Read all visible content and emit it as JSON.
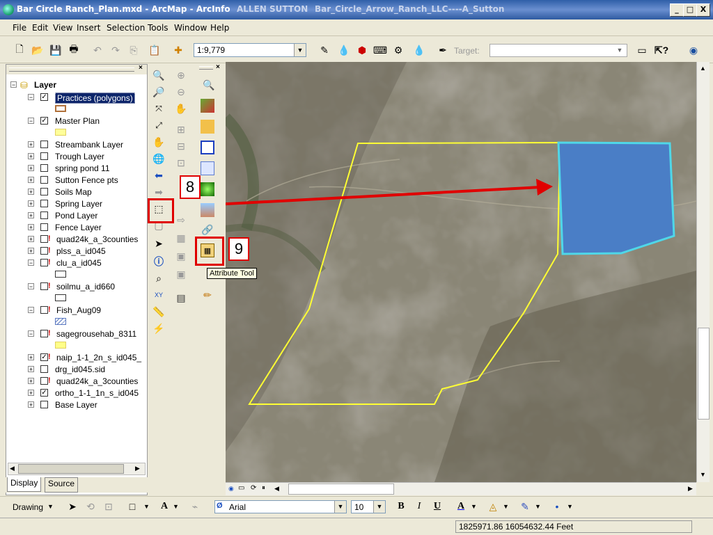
{
  "window": {
    "title": "Bar Circle Ranch_Plan.mxd - ArcMap - ArcInfo",
    "user": "ALLEN SUTTON",
    "folder": "Bar_Circle_Arrow_Ranch_LLC----A_Sutton",
    "min": "_",
    "max": "□",
    "close": "X"
  },
  "menu": [
    "File",
    "Edit",
    "View",
    "Insert",
    "Selection",
    "Tools",
    "Window",
    "Help"
  ],
  "toolbar": {
    "scale": "1:9,779",
    "target_label": "Target:"
  },
  "toc": {
    "root": "Layer",
    "layers": [
      {
        "name": "Practices (polygons)",
        "checked": true,
        "expanded": true,
        "warn": false,
        "selected": true,
        "symbol": "#b0703a"
      },
      {
        "name": "Master Plan",
        "checked": true,
        "expanded": true,
        "warn": false,
        "symbol": "#ffff99"
      },
      {
        "name": "Streambank Layer",
        "checked": false,
        "expanded": false,
        "warn": false
      },
      {
        "name": "Trough Layer",
        "checked": false,
        "expanded": false,
        "warn": false
      },
      {
        "name": "spring pond 11",
        "checked": false,
        "expanded": false,
        "warn": false
      },
      {
        "name": "Sutton Fence pts",
        "checked": false,
        "expanded": false,
        "warn": false
      },
      {
        "name": "Soils Map",
        "checked": false,
        "expanded": false,
        "warn": false
      },
      {
        "name": "Spring Layer",
        "checked": false,
        "expanded": false,
        "warn": false
      },
      {
        "name": "Pond Layer",
        "checked": false,
        "expanded": false,
        "warn": false
      },
      {
        "name": "Fence Layer",
        "checked": false,
        "expanded": false,
        "warn": false
      },
      {
        "name": "quad24k_a_3counties",
        "checked": false,
        "expanded": false,
        "warn": true
      },
      {
        "name": "plss_a_id045",
        "checked": false,
        "expanded": false,
        "warn": true
      },
      {
        "name": "clu_a_id045",
        "checked": false,
        "expanded": true,
        "warn": true,
        "symbol": "#ffffff"
      },
      {
        "name": "soilmu_a_id660",
        "checked": false,
        "expanded": true,
        "warn": true,
        "symbol": "#ffffff"
      },
      {
        "name": "Fish_Aug09",
        "checked": false,
        "expanded": true,
        "warn": true,
        "symbol": "hatch"
      },
      {
        "name": "sagegrousehab_8311",
        "checked": false,
        "expanded": true,
        "warn": true,
        "symbol": "#ffff88"
      },
      {
        "name": "naip_1-1_2n_s_id045_",
        "checked": true,
        "expanded": false,
        "warn": true
      },
      {
        "name": "drg_id045.sid",
        "checked": false,
        "expanded": false,
        "warn": false
      },
      {
        "name": "quad24k_a_3counties",
        "checked": false,
        "expanded": false,
        "warn": true
      },
      {
        "name": "ortho_1-1_1n_s_id045",
        "checked": true,
        "expanded": false,
        "warn": false
      },
      {
        "name": "Base Layer",
        "checked": false,
        "expanded": false,
        "warn": false
      }
    ],
    "tabs": [
      "Display",
      "Source"
    ]
  },
  "annotations": {
    "step8": "8",
    "step9": "9",
    "tooltip": "Attribute Tool"
  },
  "drawing": {
    "label": "Drawing",
    "font": "Arial",
    "size": "10",
    "bold": "B",
    "italic": "I",
    "underline": "U"
  },
  "status": {
    "coords": "1825971.86  16054632.44 Feet"
  },
  "colors": {
    "annotation": "#e00000",
    "polygon_fill": "#4a7ec6",
    "polygon_outline": "#4fd7e8",
    "plan_outline": "#ffff33"
  }
}
